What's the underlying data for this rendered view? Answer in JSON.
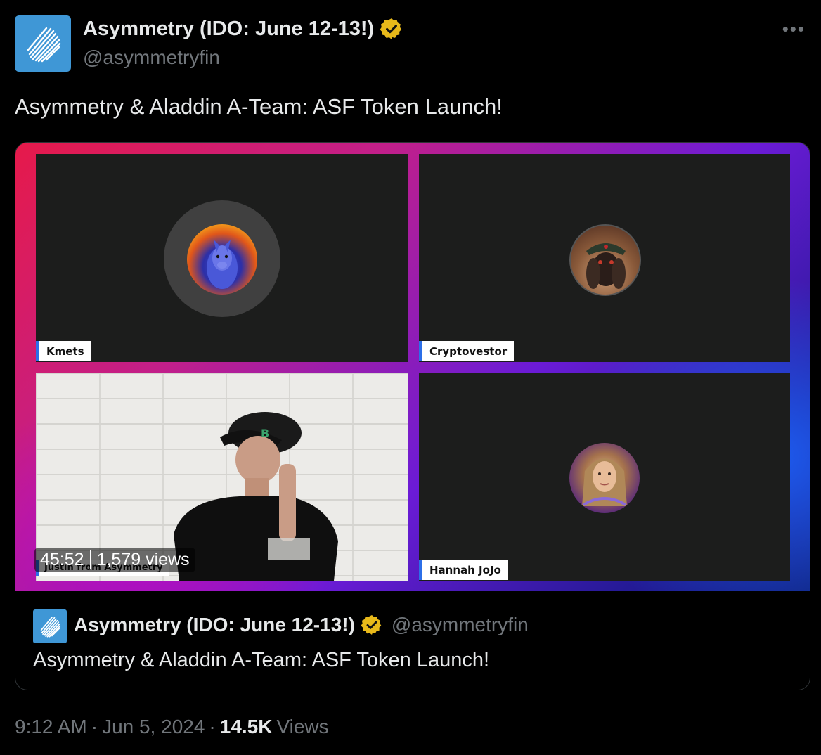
{
  "author": {
    "display_name": "Asymmetry (IDO: June 12-13!)",
    "handle": "@asymmetryfin",
    "verified_icon": "verified-badge-icon",
    "badge_color": "#e8b91a",
    "logo_color": "#3f97d6"
  },
  "more_label": "•••",
  "tweet": {
    "text": "Asymmetry & Aladdin A-Team: ASF Token Launch!"
  },
  "media": {
    "participants": [
      "Kmets",
      "Cryptovestor",
      "Justin from Asymmetry",
      "Hannah JoJo"
    ],
    "duration": "45:52",
    "views": "1,579 views"
  },
  "quote": {
    "display_name": "Asymmetry (IDO: June 12-13!)",
    "handle": "@asymmetryfin",
    "text": "Asymmetry & Aladdin A-Team: ASF Token Launch!"
  },
  "meta": {
    "time": "9:12 AM",
    "sep1": "·",
    "date": "Jun 5, 2024",
    "sep2": "·",
    "view_count": "14.5K",
    "views_label": "Views"
  }
}
